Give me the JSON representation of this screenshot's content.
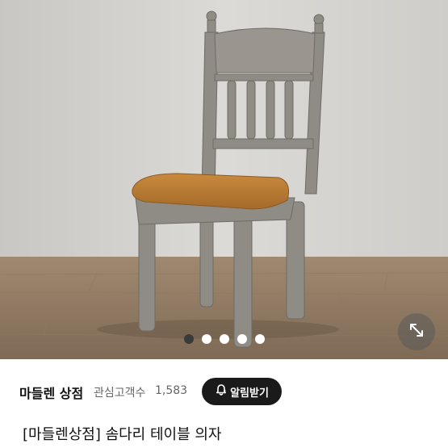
{
  "product": {
    "image_alt": "chair-photo",
    "image_count": 5,
    "active_image_index": 0,
    "title": "[마들렌상점] 솜다리 테이블 의자"
  },
  "seller": {
    "name": "마들렌 상점",
    "follower_label": "관심고객수",
    "follower_count": "1,583",
    "notify_button_label": "알림받기"
  },
  "icons": {
    "expand": "expand-arrows-icon",
    "bell": "bell-icon"
  },
  "colors": {
    "notify_button_bg": "#1a1a1a",
    "dot_active": "#3a3a3a",
    "dot_inactive": "#ffffff"
  }
}
